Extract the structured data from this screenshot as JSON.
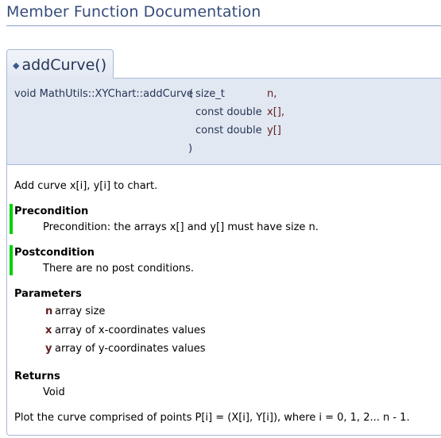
{
  "section_title": "Member Function Documentation",
  "function": {
    "bullet": "◆",
    "name": "addCurve()"
  },
  "prototype": {
    "signature": "void MathUtils::XYChart::addCurve",
    "open_paren": "(",
    "close_paren": ")",
    "params": [
      {
        "type": "size_t",
        "name": "n,"
      },
      {
        "type": "const double",
        "name": "x[],"
      },
      {
        "type": "const double",
        "name": "y[]"
      }
    ]
  },
  "doc": {
    "brief": "Add curve x[i], y[i] to chart.",
    "precondition": {
      "title": "Precondition",
      "text": "Precondition: the arrays x[] and y[] must have size n."
    },
    "postcondition": {
      "title": "Postcondition",
      "text": "There are no post conditions."
    },
    "parameters": {
      "title": "Parameters",
      "items": [
        {
          "name": "n",
          "desc": "array size"
        },
        {
          "name": "x",
          "desc": "array of x-coordinates values"
        },
        {
          "name": "y",
          "desc": "array of y-coordinates values"
        }
      ]
    },
    "returns": {
      "title": "Returns",
      "text": "Void"
    },
    "details": "Plot the curve comprised of points P[i] = (X[i], Y[i]), where i = 0, 1, 2... n - 1."
  }
}
